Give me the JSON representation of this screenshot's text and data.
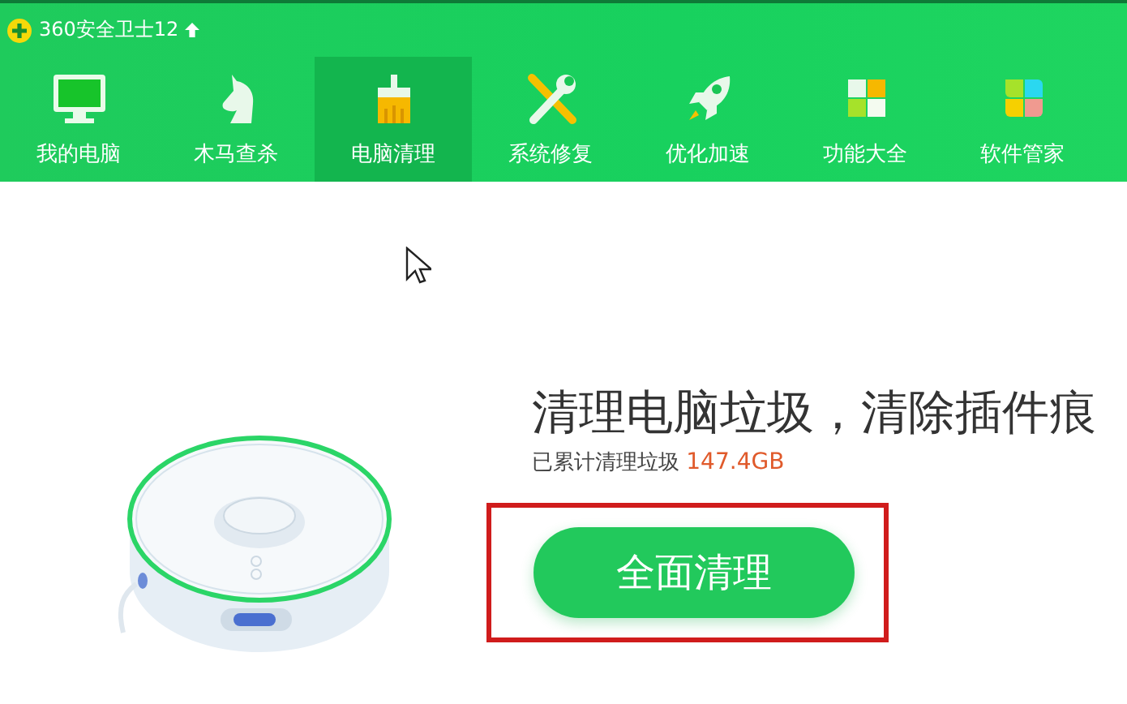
{
  "app": {
    "title": "360安全卫士12"
  },
  "tabs": [
    {
      "label": "我的电脑",
      "kind": "computer",
      "selected": false
    },
    {
      "label": "木马查杀",
      "kind": "horse",
      "selected": false
    },
    {
      "label": "电脑清理",
      "kind": "broom",
      "selected": true
    },
    {
      "label": "系统修复",
      "kind": "tools",
      "selected": false
    },
    {
      "label": "优化加速",
      "kind": "rocket",
      "selected": false
    },
    {
      "label": "功能大全",
      "kind": "grid",
      "selected": false
    },
    {
      "label": "软件管家",
      "kind": "apps",
      "selected": false
    }
  ],
  "cleanup": {
    "headline": "清理电脑垃圾，清除插件痕",
    "total_label": "已累计清理垃圾",
    "total_value": "147.4GB",
    "button": "全面清理"
  }
}
